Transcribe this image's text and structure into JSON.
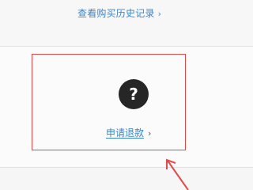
{
  "history": {
    "label": "查看购买历史记录",
    "chevron": "›"
  },
  "refund": {
    "label": "申请退款",
    "chevron": "›"
  },
  "help_icon": {
    "glyph": "?",
    "icon": "question-mark-icon"
  },
  "annotation": {
    "highlight_color": "#e24a48"
  },
  "colors": {
    "link": "#3f86c7",
    "icon_bg": "#262626",
    "background": "#f6f6f6"
  }
}
